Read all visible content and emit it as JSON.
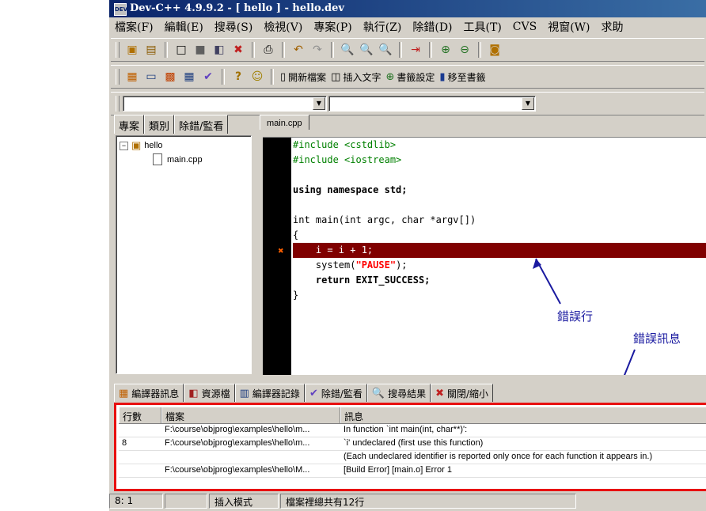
{
  "window": {
    "title": "Dev-C++ 4.9.9.2  -  [ hello ] - hello.dev",
    "icon_label": "DEV"
  },
  "menu": [
    "檔案(F)",
    "編輯(E)",
    "搜尋(S)",
    "檢視(V)",
    "專案(P)",
    "執行(Z)",
    "除錯(D)",
    "工具(T)",
    "CVS",
    "視窗(W)",
    "求助"
  ],
  "toolbar2": {
    "new_bookmark": "開新檔案",
    "insert_text": "插入文字",
    "set_bookmark": "書籤設定",
    "goto_bookmark": "移至書籤"
  },
  "left_tabs": [
    "專案",
    "類別",
    "除錯/監看"
  ],
  "tree": {
    "root": "hello",
    "child": "main.cpp"
  },
  "editor": {
    "tab": "main.cpp",
    "lines": [
      "#include <cstdlib>",
      "#include <iostream>",
      "",
      "using namespace std;",
      "",
      "int main(int argc, char *argv[])",
      "{",
      "    i = i + 1;",
      "    system(\"PAUSE\");",
      "    return EXIT_SUCCESS;",
      "}"
    ],
    "error_line_index": 7
  },
  "annotations": {
    "error_line": "錯誤行",
    "error_message": "錯誤訊息"
  },
  "bottom_tabs": [
    "編譯器訊息",
    "資源檔",
    "編譯器記錄",
    "除錯/監看",
    "搜尋結果",
    "關閉/縮小"
  ],
  "messages": {
    "headers": [
      "行數",
      "檔案",
      "訊息"
    ],
    "rows": [
      {
        "line": "",
        "file": "F:\\course\\objprog\\examples\\hello\\m...",
        "msg": "In function `int main(int, char**)':"
      },
      {
        "line": "8",
        "file": "F:\\course\\objprog\\examples\\hello\\m...",
        "msg": "`i' undeclared (first use this function)"
      },
      {
        "line": "",
        "file": "",
        "msg": "(Each undeclared identifier is reported only once for each function it appears in.)"
      },
      {
        "line": "",
        "file": "F:\\course\\objprog\\examples\\hello\\M...",
        "msg": "[Build Error]  [main.o] Error 1"
      }
    ]
  },
  "status": {
    "position": "8: 1",
    "mode": "插入模式",
    "lines_info": "檔案裡總共有12行"
  }
}
